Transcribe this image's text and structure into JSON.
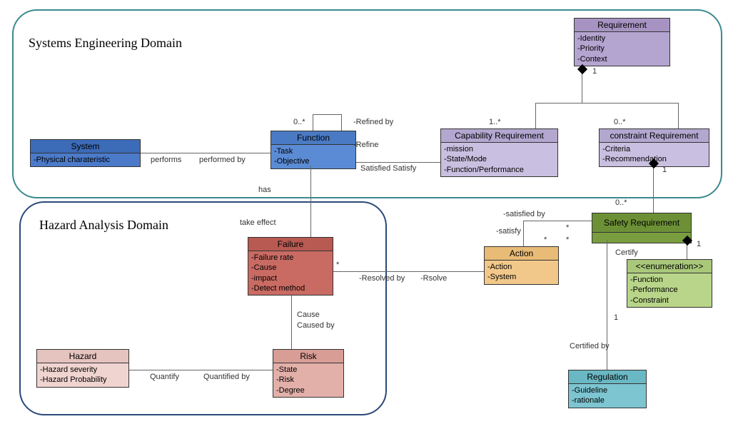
{
  "domains": {
    "sysEng": "Systems Engineering Domain",
    "hazAna": "Hazard Analysis Domain"
  },
  "classes": {
    "system": {
      "name": "System",
      "attrs": [
        "Physical charateristic"
      ]
    },
    "function": {
      "name": "Function",
      "attrs": [
        "Task",
        "Objective"
      ]
    },
    "capreq": {
      "name": "Capability Requirement",
      "attrs": [
        "mission",
        "State/Mode",
        "Function/Performance"
      ]
    },
    "conreq": {
      "name": "constraint Requirement",
      "attrs": [
        "Criteria",
        "Recommendation"
      ]
    },
    "requirement": {
      "name": "Requirement",
      "attrs": [
        "Identity",
        "Priority",
        "Context"
      ]
    },
    "safreq": {
      "name": "Safety Requirement",
      "attrs": []
    },
    "enum": {
      "name": "<<enumeration>>",
      "attrs": [
        "Function",
        "Performance",
        "Constraint"
      ]
    },
    "failure": {
      "name": "Failure",
      "attrs": [
        "Failure rate",
        "Cause",
        "impact",
        "Detect method"
      ]
    },
    "risk": {
      "name": "Risk",
      "attrs": [
        "State",
        "Risk",
        "Degree"
      ]
    },
    "hazard": {
      "name": "Hazard",
      "attrs": [
        "Hazard severity",
        "Hazard Probability"
      ]
    },
    "action": {
      "name": "Action",
      "attrs": [
        "Action",
        "System"
      ]
    },
    "regulation": {
      "name": "Regulation",
      "attrs": [
        "Guideline",
        "rationale"
      ]
    }
  },
  "labels": {
    "performs": "performs",
    "performedBy": "performed by",
    "refinedBy": "-Refined by",
    "refine": "-Refine",
    "satisfiedSatisfy": "Satisfied Satisfy",
    "has": "has",
    "takeEffect": "take effect",
    "resolvedBy": "-Resolved by",
    "resolve": "-Rsolve",
    "satisfiedBy": "-satisfied by",
    "satisfy": "-satisfy",
    "cause": "Cause",
    "causedBy": "Caused by",
    "quantify": "Quantify",
    "quantifiedBy": "Quantified by",
    "certify": "Certify",
    "certifiedBy": "Certified by",
    "mult0": "0..*",
    "mult1": "1",
    "mult1x": "1..*",
    "star": "*"
  }
}
